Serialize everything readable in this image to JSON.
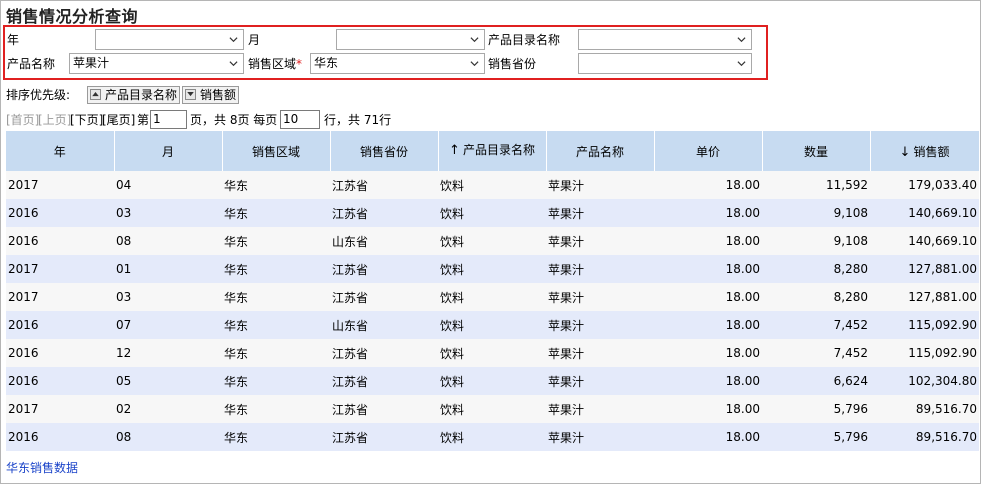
{
  "title": "销售情况分析查询",
  "filters": {
    "year_label": "年",
    "month_label": "月",
    "catalog_label": "产品目录名称",
    "product_label": "产品名称",
    "product_value": "苹果汁",
    "region_label": "销售区域",
    "region_required": "*",
    "region_value": "华东",
    "province_label": "销售省份"
  },
  "sort": {
    "label": "排序优先级:",
    "items": [
      "产品目录名称",
      "销售额"
    ]
  },
  "pager": {
    "first": "[首页]",
    "prev": "[上页]",
    "next": "[下页]",
    "last": "[尾页]",
    "page_prefix": "第",
    "page_value": "1",
    "page_suffix": "页，共 8页 每页",
    "size_value": "10",
    "size_suffix": "行，共 71行"
  },
  "table": {
    "columns": [
      "年",
      "月",
      "销售区域",
      "销售省份",
      "产品目录名称",
      "产品名称",
      "单价",
      "数量",
      "销售额"
    ],
    "rows": [
      [
        "2017",
        "04",
        "华东",
        "江苏省",
        "饮料",
        "苹果汁",
        "18.00",
        "11,592",
        "179,033.40"
      ],
      [
        "2016",
        "03",
        "华东",
        "江苏省",
        "饮料",
        "苹果汁",
        "18.00",
        "9,108",
        "140,669.10"
      ],
      [
        "2016",
        "08",
        "华东",
        "山东省",
        "饮料",
        "苹果汁",
        "18.00",
        "9,108",
        "140,669.10"
      ],
      [
        "2017",
        "01",
        "华东",
        "江苏省",
        "饮料",
        "苹果汁",
        "18.00",
        "8,280",
        "127,881.00"
      ],
      [
        "2017",
        "03",
        "华东",
        "江苏省",
        "饮料",
        "苹果汁",
        "18.00",
        "8,280",
        "127,881.00"
      ],
      [
        "2016",
        "07",
        "华东",
        "山东省",
        "饮料",
        "苹果汁",
        "18.00",
        "7,452",
        "115,092.90"
      ],
      [
        "2016",
        "12",
        "华东",
        "江苏省",
        "饮料",
        "苹果汁",
        "18.00",
        "7,452",
        "115,092.90"
      ],
      [
        "2016",
        "05",
        "华东",
        "江苏省",
        "饮料",
        "苹果汁",
        "18.00",
        "6,624",
        "102,304.80"
      ],
      [
        "2017",
        "02",
        "华东",
        "江苏省",
        "饮料",
        "苹果汁",
        "18.00",
        "5,796",
        "89,516.70"
      ],
      [
        "2016",
        "08",
        "华东",
        "江苏省",
        "饮料",
        "苹果汁",
        "18.00",
        "5,796",
        "89,516.70"
      ]
    ]
  },
  "footer_link": "华东销售数据",
  "colors": {
    "header_bg": "#c7dbf1",
    "row_odd": "#f7f7f7",
    "row_even": "#e4eafa",
    "highlight_border": "#e02020",
    "link": "#1a43c9"
  }
}
